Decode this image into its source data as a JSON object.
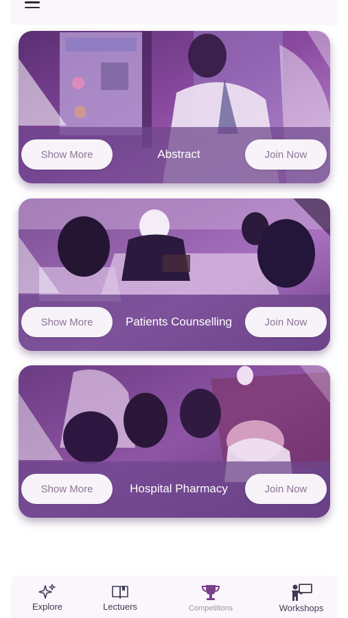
{
  "cards": [
    {
      "title": "Abstract",
      "show_more": "Show More",
      "join_now": "Join Now"
    },
    {
      "title": "Patients Counselling",
      "show_more": "Show More",
      "join_now": "Join Now"
    },
    {
      "title": "Hospital Pharmacy",
      "show_more": "Show More",
      "join_now": "Join Now"
    }
  ],
  "nav": {
    "items": [
      {
        "label": "Explore",
        "icon": "sparkles-icon"
      },
      {
        "label": "Lectuers",
        "icon": "book-icon"
      },
      {
        "label": "Competitions",
        "icon": "trophy-icon",
        "active": true
      },
      {
        "label": "Workshops",
        "icon": "presenter-icon"
      }
    ]
  },
  "colors": {
    "accent": "#7b3f8c",
    "card_overlay": "#6e468c",
    "pill_bg": "#f7f3f8",
    "pill_text": "#8c7496",
    "nav_bg": "#faf6fb"
  }
}
